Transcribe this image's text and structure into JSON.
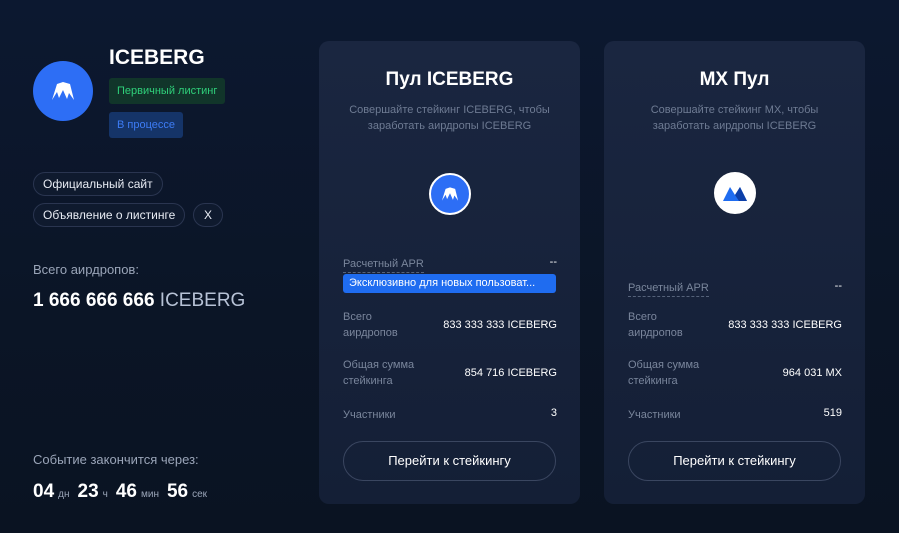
{
  "token": {
    "name": "ICEBERG",
    "badge_primary": "Первичный листинг",
    "badge_status": "В процессе",
    "links": {
      "site": "Официальный сайт",
      "listing": "Объявление о листинге",
      "x": "X"
    },
    "total_label": "Всего аирдропов:",
    "total_amount": "1 666 666 666",
    "total_unit": "ICEBERG",
    "ends_label": "Событие закончится через:",
    "timer": {
      "days": "04",
      "days_unit": "дн",
      "hours": "23",
      "hours_unit": "ч",
      "minutes": "46",
      "minutes_unit": "мин",
      "seconds": "56",
      "seconds_unit": "сек"
    }
  },
  "pools": [
    {
      "title": "Пул ICEBERG",
      "subtitle": "Совершайте стейкинг ICEBERG, чтобы заработать аирдропы ICEBERG",
      "icon": "iceberg-logo",
      "apr_label": "Расчетный APR",
      "apr_value": "--",
      "exclusive": "Эксклюзивно для новых пользоват...",
      "airdrops_label": "Всего аирдропов",
      "airdrops_value": "833 333 333 ICEBERG",
      "staking_label": "Общая сумма стейкинга",
      "staking_value": "854 716 ICEBERG",
      "participants_label": "Участники",
      "participants_value": "3",
      "button": "Перейти к стейкингу"
    },
    {
      "title": "MX Пул",
      "subtitle": "Совершайте стейкинг MX, чтобы заработать аирдропы ICEBERG",
      "icon": "mx-logo",
      "apr_label": "Расчетный APR",
      "apr_value": "--",
      "airdrops_label": "Всего аирдропов",
      "airdrops_value": "833 333 333 ICEBERG",
      "staking_label": "Общая сумма стейкинга",
      "staking_value": "964 031 MX",
      "participants_label": "Участники",
      "participants_value": "519",
      "button": "Перейти к стейкингу"
    }
  ],
  "colors": {
    "accent": "#2d6ef5",
    "green": "#2fd07a",
    "background": "#0b1526",
    "card": "#172239"
  }
}
